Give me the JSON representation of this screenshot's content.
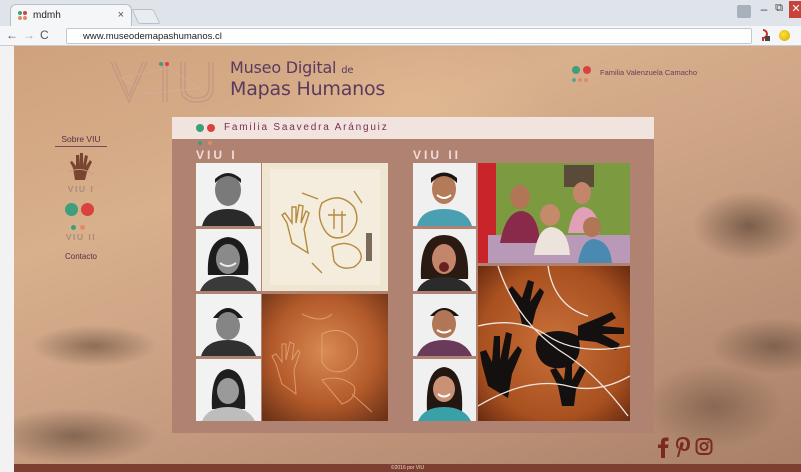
{
  "browser": {
    "tab_title": "mdmh",
    "tab_close": "×",
    "url": "www.museodemapashumanos.cl",
    "back": "←",
    "forward": "→",
    "reload": "C",
    "win_min": "–",
    "win_max": "⧉",
    "win_close": "✕"
  },
  "site": {
    "title_line1": "Museo Digital",
    "title_line1_small": "de",
    "title_line2": "Mapas Humanos",
    "logo_alt": "VIU",
    "family_link": "Familia Valenzuela Camacho"
  },
  "sidebar": {
    "sobre": "Sobre VIU",
    "viu1": "VIU I",
    "viu2": "VIU II",
    "contacto": "Contacto"
  },
  "panel": {
    "title": "Familia Saavedra Aránguiz",
    "viu1": "VIU I",
    "viu2": "VIU II"
  },
  "footer": {
    "text": "©2016 por VIU"
  },
  "icons": [
    "facebook-icon",
    "pinterest-icon",
    "instagram-icon",
    "hand-icon"
  ],
  "colors": {
    "dot_green": "#3f9e7b",
    "dot_red": "#d9423f",
    "title_purple": "#5a3a5e",
    "panel_brown": "#b08272",
    "footer_brown": "#7b4032"
  }
}
